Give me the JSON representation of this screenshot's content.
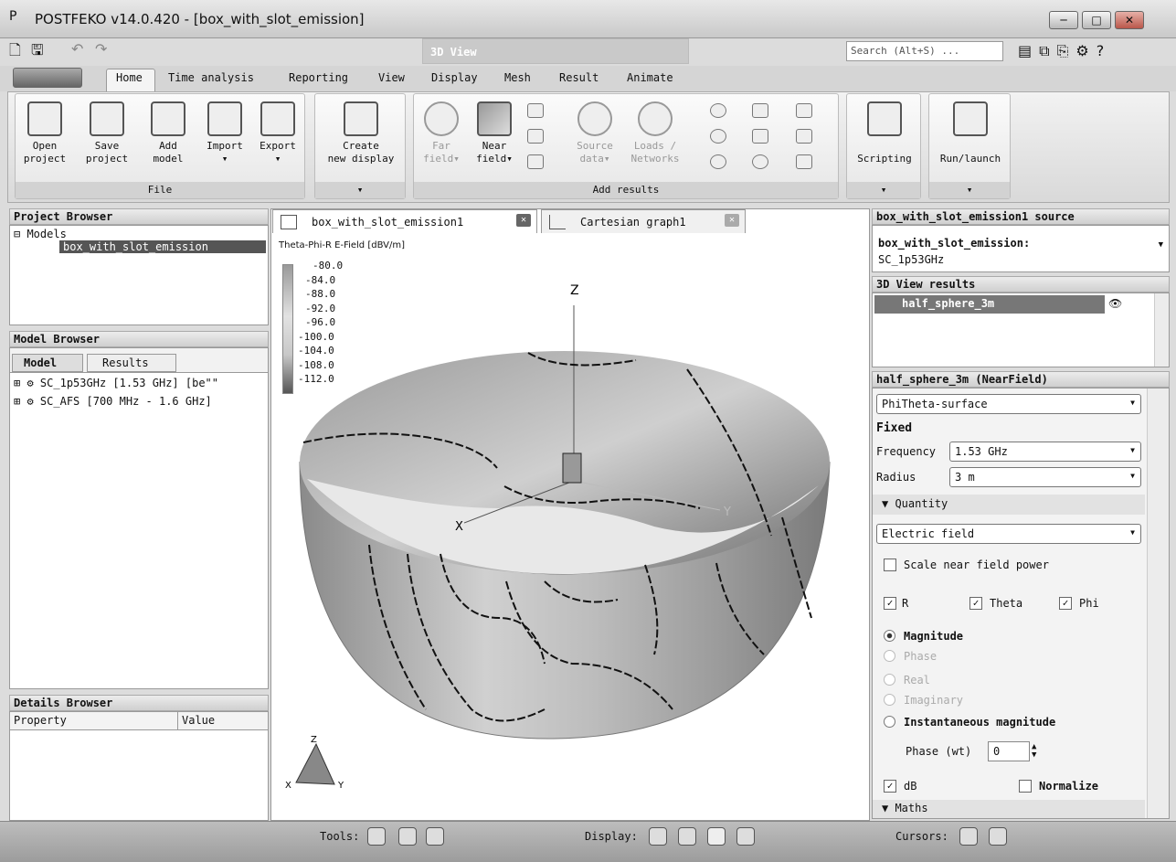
{
  "window": {
    "title": "POSTFEKO v14.0.420 - [box_with_slot_emission]",
    "buttons": [
      "─",
      "□",
      "✕"
    ],
    "app_icon": "P"
  },
  "quick_access": {
    "icons": [
      "new-file-icon",
      "save-icon",
      "undo-icon",
      "redo-icon"
    ]
  },
  "context_tab": "3D View",
  "search": {
    "placeholder": "Search (Alt+S) ..."
  },
  "ribbon_tabs": [
    "Home",
    "Time analysis",
    "Reporting",
    "View",
    "Display",
    "Mesh",
    "Result",
    "Animate"
  ],
  "ribbon": {
    "file_group": {
      "label": "File",
      "buttons": [
        {
          "line1": "Open",
          "line2": "project"
        },
        {
          "line1": "Save",
          "line2": "project"
        },
        {
          "line1": "Add",
          "line2": "model"
        },
        {
          "line1": "Import",
          "line2": "▾"
        },
        {
          "line1": "Export",
          "line2": "▾"
        }
      ]
    },
    "display_group": {
      "line1": "Create",
      "line2": "new display",
      "label": "▾"
    },
    "results_group": {
      "label": "Add results",
      "buttons": [
        {
          "line1": "Far",
          "line2": "field▾"
        },
        {
          "line1": "Near",
          "line2": "field▾"
        },
        {
          "line1": "Source",
          "line2": "data▾"
        },
        {
          "line1": "Loads /",
          "line2": "Networks"
        }
      ]
    },
    "scripting_group": {
      "label": "Scripting",
      "group_label": "▾"
    },
    "run_group": {
      "label": "Run/launch",
      "group_label": "▾"
    }
  },
  "project_browser": {
    "title": "Project Browser",
    "root": "Models",
    "selected": "box_with_slot_emission"
  },
  "model_browser": {
    "title": "Model Browser",
    "tabs": [
      "Model",
      "Results"
    ],
    "items": [
      "SC_1p53GHz [1.53 GHz] [be\"\"",
      "SC_AFS [700 MHz - 1.6 GHz]"
    ]
  },
  "details_browser": {
    "title": "Details Browser",
    "columns": [
      "Property",
      "Value"
    ]
  },
  "doc_tabs": [
    {
      "label": "box_with_slot_emission1"
    },
    {
      "label": "Cartesian graph1"
    }
  ],
  "view3d": {
    "legend_title": "Theta-Phi-R E-Field [dBV/m]",
    "legend_values": [
      "-80.0",
      "-84.0",
      "-88.0",
      "-92.0",
      "-96.0",
      "-100.0",
      "-104.0",
      "-108.0",
      "-112.0"
    ],
    "axis_z": "Z",
    "axis_x": "X",
    "axis_y": "Y",
    "triad_z": "Z",
    "triad_x": "X",
    "triad_y": "Y"
  },
  "right_panel": {
    "source_header": "box_with_slot_emission1 source",
    "source_line1": "box_with_slot_emission:",
    "source_line2": "SC_1p53GHz",
    "results_header": "3D View results",
    "result_item": "half_sphere_3m",
    "nf_header": "half_sphere_3m (NearField)",
    "surface_type": "PhiTheta-surface",
    "fixed_label": "Fixed",
    "frequency_label": "Frequency",
    "frequency_value": "1.53 GHz",
    "radius_label": "Radius",
    "radius_value": "3 m",
    "quantity_header": "Quantity",
    "quantity_value": "Electric field",
    "scale_label": "Scale near field power",
    "comp_r": "R",
    "comp_theta": "Theta",
    "comp_phi": "Phi",
    "mag": "Magnitude",
    "phase": "Phase",
    "real": "Real",
    "imag": "Imaginary",
    "inst": "Instantaneous magnitude",
    "phase_wt_label": "Phase (wt)",
    "phase_wt_value": "0",
    "db_label": "dB",
    "normalize_label": "Normalize",
    "maths_header": "Maths"
  },
  "status_bar": {
    "tools_label": "Tools:",
    "display_label": "Display:",
    "cursors_label": "Cursors:"
  }
}
